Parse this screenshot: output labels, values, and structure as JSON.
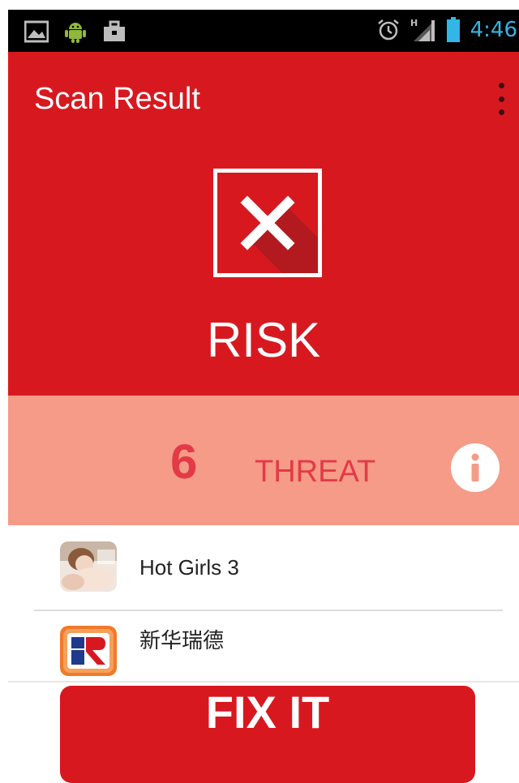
{
  "status_bar": {
    "time": "4:46",
    "icons": [
      "gallery-icon",
      "android-icon",
      "briefcase-icon",
      "alarm-icon",
      "signal-h-icon",
      "battery-icon"
    ]
  },
  "header": {
    "title": "Scan Result",
    "menu_icon": "more-vert-icon",
    "status_icon": "close-icon",
    "status_text": "RISK",
    "color": "#d7191f"
  },
  "threat": {
    "count": "6",
    "label": "THREAT",
    "info_icon": "info-icon",
    "panel_color": "#f59b88",
    "text_color": "#e33a47"
  },
  "apps": [
    {
      "name": "Hot Girls 3",
      "icon": "app-thumbnail-icon"
    },
    {
      "name": "新华瑞德",
      "icon": "app-logo-icon"
    }
  ],
  "action": {
    "fix_label": "FIX IT"
  }
}
